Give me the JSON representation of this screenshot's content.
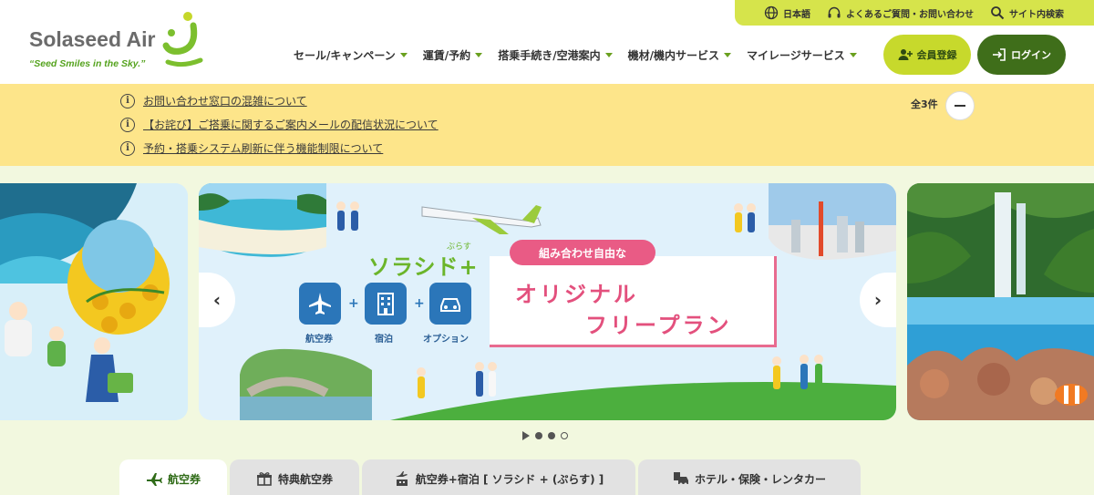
{
  "brand": {
    "name": "Solaseed Air",
    "tagline": "“Seed Smiles in the Sky.”",
    "accent": "#c7d92c",
    "dark_green": "#3f6e1a"
  },
  "utility": [
    {
      "icon": "globe-icon",
      "label": "日本語"
    },
    {
      "icon": "headset-icon",
      "label": "よくあるご質問・お問い合わせ"
    },
    {
      "icon": "search-icon",
      "label": "サイト内検索"
    }
  ],
  "nav": [
    "セール/キャンペーン",
    "運賃/予約",
    "搭乗手続き/空港案内",
    "機材/機内サービス",
    "マイレージサービス"
  ],
  "buttons": {
    "register": "会員登録",
    "login": "ログイン"
  },
  "notices": {
    "count": "全3件",
    "items": [
      "お問い合わせ窓口の混雑について",
      "【お詫び】ご搭乗に関するご案内メールの配信状況について",
      "予約・搭乗システム刷新に伴う機能制限について"
    ]
  },
  "banner": {
    "brand": "ソラシド+",
    "brand_ruby": "ぷらす",
    "services": [
      "航空券",
      "宿泊",
      "オプション"
    ],
    "tag": "組み合わせ自由な",
    "headline1": "オリジナル",
    "headline2": "フリープラン"
  },
  "tabs": [
    {
      "icon": "airplane-icon",
      "label": "航空券",
      "active": true
    },
    {
      "icon": "gift-icon",
      "label": "特典航空券",
      "active": false
    },
    {
      "icon": "plane-hotel-icon",
      "label": "航空券+宿泊 [ ソラシド + (ぷらす) ]",
      "active": false
    },
    {
      "icon": "car-icon",
      "label": "ホテル・保険・レンタカー",
      "active": false
    }
  ]
}
